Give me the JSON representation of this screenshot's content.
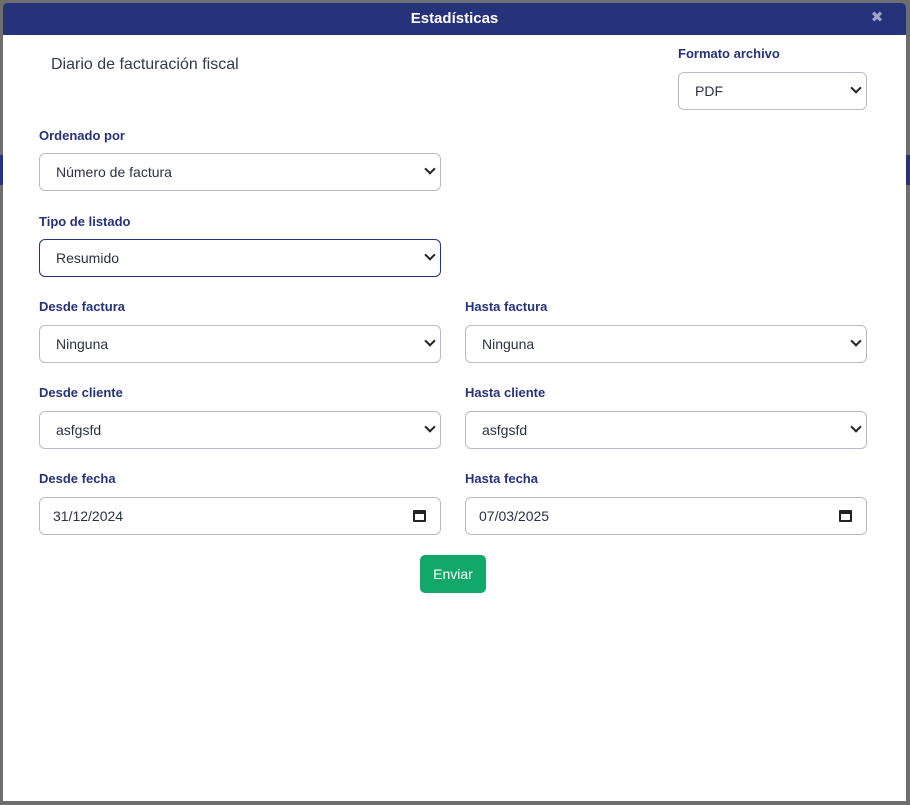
{
  "dialog": {
    "title": "Estadísticas",
    "close_glyph": "✖",
    "report_title": "Diario de facturación fiscal"
  },
  "form": {
    "formato": {
      "label": "Formato archivo",
      "value": "PDF"
    },
    "ordenado": {
      "label": "Ordenado por",
      "value": "Número de factura"
    },
    "tipo": {
      "label": "Tipo de listado",
      "value": "Resumido"
    },
    "desde_factura": {
      "label": "Desde factura",
      "value": "Ninguna"
    },
    "hasta_factura": {
      "label": "Hasta factura",
      "value": "Ninguna"
    },
    "desde_cliente": {
      "label": "Desde cliente",
      "value": "asfgsfd"
    },
    "hasta_cliente": {
      "label": "Hasta cliente",
      "value": "asfgsfd"
    },
    "desde_fecha": {
      "label": "Desde fecha",
      "value": "31/12/2024"
    },
    "hasta_fecha": {
      "label": "Hasta fecha",
      "value": "07/03/2025"
    },
    "submit_label": "Enviar"
  },
  "colors": {
    "primary": "#26327a",
    "success": "#12a86a",
    "border": "#b9bcc6"
  }
}
